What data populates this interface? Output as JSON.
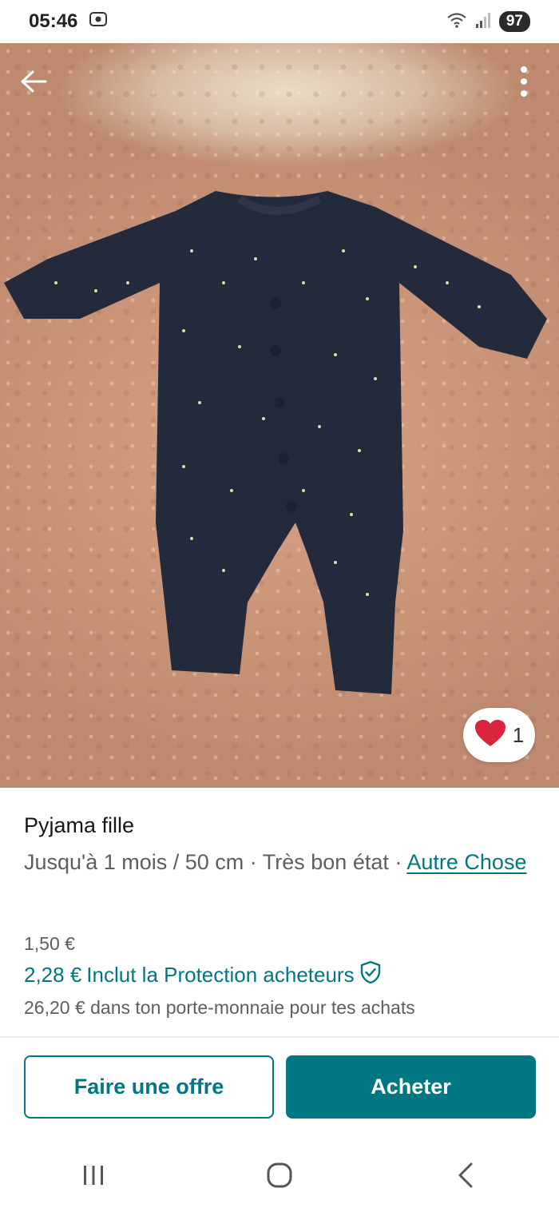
{
  "status_bar": {
    "time": "05:46",
    "battery": "97",
    "icons": [
      "screen-record-icon",
      "wifi-icon",
      "signal-icon",
      "battery-icon"
    ]
  },
  "photo": {
    "description_icons": [
      "back-arrow-icon",
      "more-vertical-icon"
    ],
    "likes": "1"
  },
  "listing": {
    "title": "Pyjama fille",
    "size_condition": "Jusqu'à 1 mois / 50 cm · Très bon état · ",
    "brand": "Autre Chose",
    "price": "1,50 €",
    "price_with_protection": "2,28 €",
    "protection_label": "Inclut la Protection acheteurs",
    "wallet_note": "26,20 € dans ton porte-monnaie pour tes achats"
  },
  "actions": {
    "offer_label": "Faire une offre",
    "buy_label": "Acheter"
  },
  "colors": {
    "accent": "#007782",
    "heart": "#d7263d"
  }
}
